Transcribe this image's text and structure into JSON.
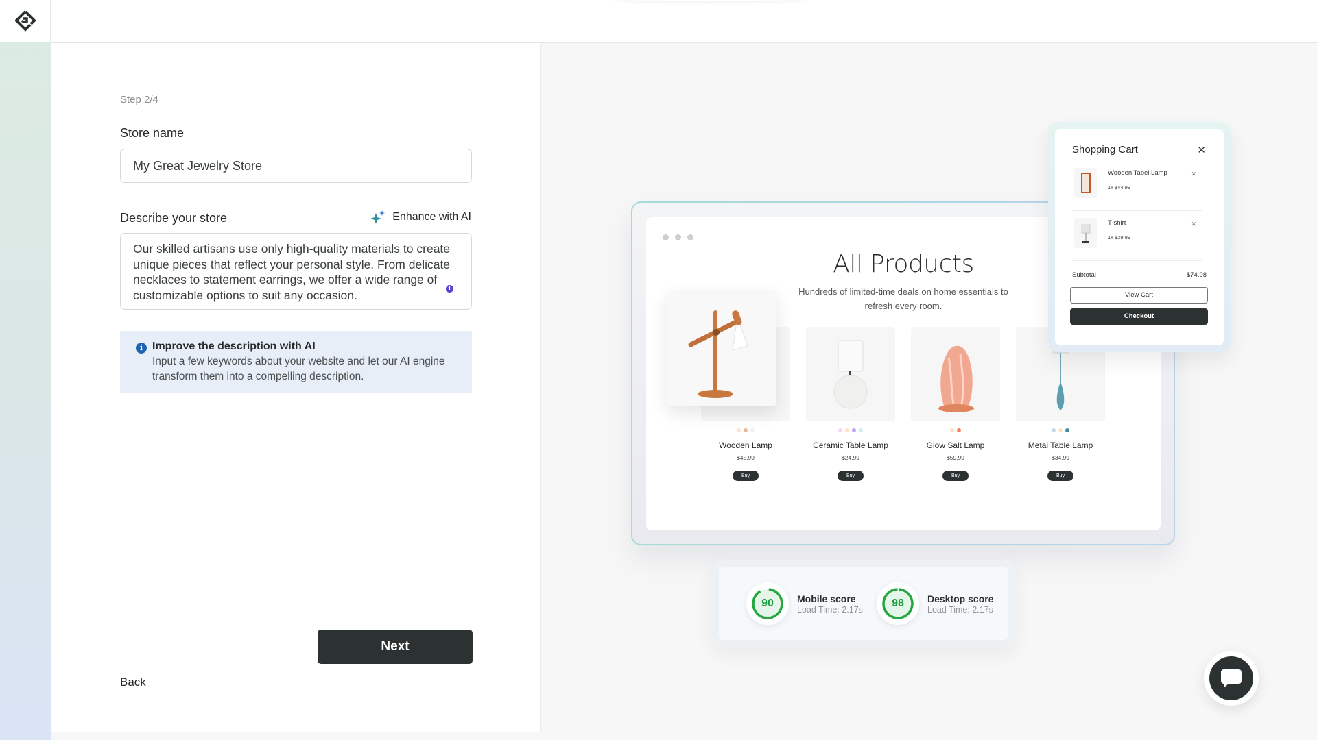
{
  "app": {
    "logo_icon": "brand-diamond-logo"
  },
  "wizard": {
    "step": "Step 2/4",
    "store_name": {
      "label": "Store name",
      "value": "My Great Jewelry Store"
    },
    "description": {
      "label": "Describe your store",
      "enhance_label": "Enhance with AI",
      "enhance_icon": "sparkle-icon",
      "value": "Our skilled artisans use only high-quality materials to create unique pieces that reflect your personal style. From delicate necklaces to statement earrings, we offer a wide range of customizable options to suit any occasion."
    },
    "info": {
      "icon": "info-icon",
      "title": "Improve the description with AI",
      "body": "Input a few keywords about your website and let our AI engine transform them into a compelling description."
    },
    "back_label": "Back",
    "next_label": "Next"
  },
  "preview": {
    "title": "All Products",
    "subtitle": "Hundreds of limited-time deals on home essentials to refresh every room.",
    "products": [
      {
        "name": "Wooden Lamp",
        "price": "$45.99",
        "buy": "Buy",
        "swatches": [
          "#fde2d2",
          "#e8b894",
          "#eef1f0"
        ]
      },
      {
        "name": "Ceramic Table Lamp",
        "price": "$24.99",
        "buy": "Buy",
        "swatches": [
          "#fbd3ef",
          "#fde0cc",
          "#b9a4f3",
          "#c9f0f7"
        ]
      },
      {
        "name": "Glow Salt Lamp",
        "price": "$59.99",
        "buy": "Buy",
        "swatches": [
          "#f7dfc4",
          "#f47d5b"
        ]
      },
      {
        "name": "Metal Table Lamp",
        "price": "$34.99",
        "buy": "Buy",
        "swatches": [
          "#c7d8e4",
          "#f3e3c8",
          "#3f8b97"
        ]
      }
    ],
    "cart": {
      "title": "Shopping Cart",
      "items": [
        {
          "name": "Wooden Tabel Lamp",
          "qty_price": "1x $44.99"
        },
        {
          "name": "T-shirt",
          "qty_price": "1x $29.99"
        }
      ],
      "subtotal_label": "Subtotal",
      "subtotal_value": "$74.98",
      "view_cart": "View Cart",
      "checkout": "Checkout"
    },
    "scores": [
      {
        "value": 90,
        "label": "Mobile score",
        "load_time": "Load Time: 2.17s"
      },
      {
        "value": 98,
        "label": "Desktop score",
        "load_time": "Load Time: 2.17s"
      }
    ],
    "score_color": "#22a83e"
  },
  "chat": {
    "icon": "chat-bubble-icon"
  }
}
